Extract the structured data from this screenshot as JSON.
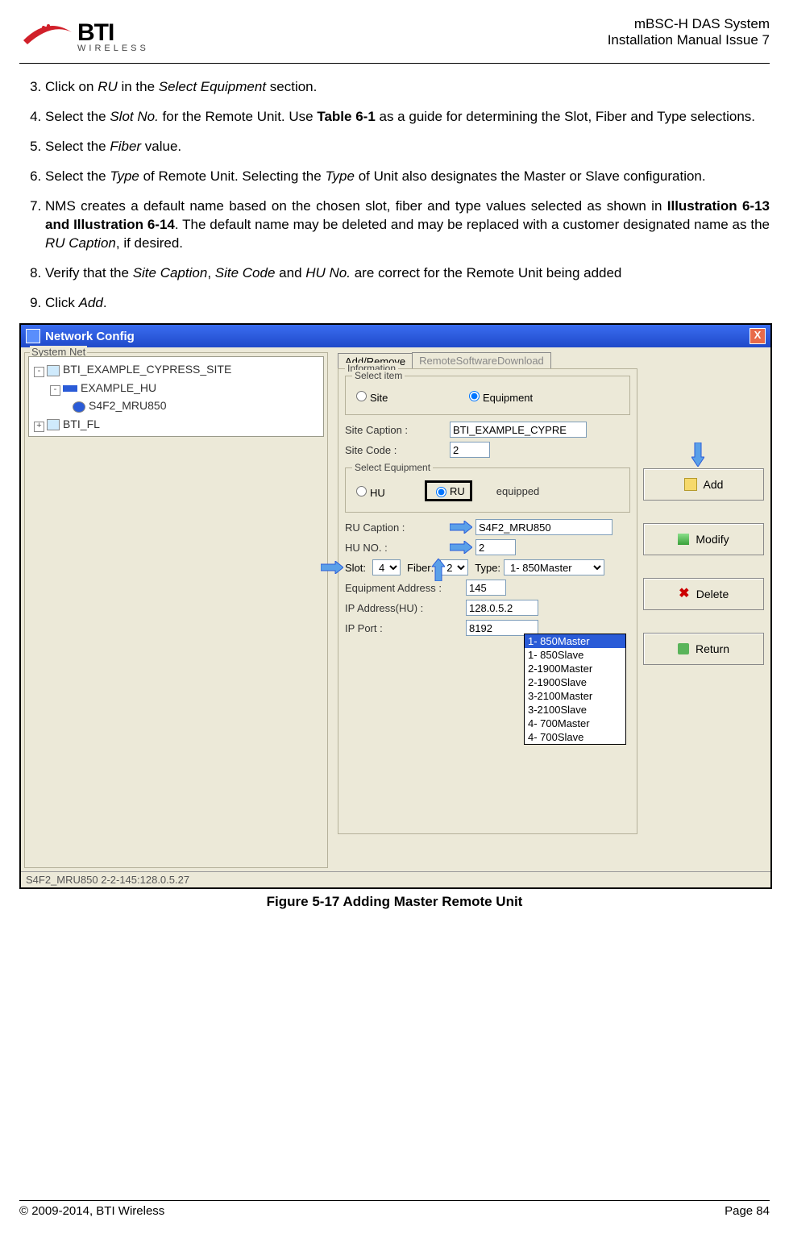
{
  "header": {
    "logo_main": "BTI",
    "logo_sub": "WIRELESS",
    "title1": "mBSC-H DAS System",
    "title2": "Installation Manual Issue 7"
  },
  "steps": {
    "s3_a": "Click on ",
    "s3_b": "RU",
    "s3_c": " in the ",
    "s3_d": "Select Equipment",
    "s3_e": " section.",
    "s4_a": "Select the ",
    "s4_b": "Slot No.",
    "s4_c": " for the Remote Unit. Use ",
    "s4_d": "Table 6-1",
    "s4_e": " as a guide for determining the Slot, Fiber and Type selections.",
    "s5_a": "Select the ",
    "s5_b": "Fiber",
    "s5_c": " value.",
    "s6_a": "Select the ",
    "s6_b": "Type",
    "s6_c": " of Remote Unit. Selecting the ",
    "s6_d": "Type",
    "s6_e": " of Unit also designates the Master or Slave configuration.",
    "s7_a": "NMS creates a default name based on the chosen slot, fiber and type values selected as shown in ",
    "s7_b": "Illustration 6-13 and Illustration 6-14",
    "s7_c": ". The default name may be deleted and may be replaced with a customer designated name as the ",
    "s7_d": "RU Caption",
    "s7_e": ", if desired.",
    "s8_a": "Verify that the ",
    "s8_b": "Site Caption",
    "s8_c": ", ",
    "s8_d": "Site Code",
    "s8_e": " and ",
    "s8_f": "HU No.",
    "s8_g": " are correct for the Remote Unit being added",
    "s9_a": "Click ",
    "s9_b": "Add",
    "s9_c": "."
  },
  "win": {
    "title": "Network Config",
    "left_label": "System Net",
    "tree": {
      "n1": "BTI_EXAMPLE_CYPRESS_SITE",
      "n2": "EXAMPLE_HU",
      "n3": "S4F2_MRU850",
      "n4": "BTI_FL"
    },
    "tabs": {
      "t1": "Add/Remove",
      "t2": "RemoteSoftwareDownload"
    },
    "info_label": "Information",
    "select_item": "Select item",
    "site": "Site",
    "equipment": "Equipment",
    "site_caption_lbl": "Site Caption :",
    "site_caption_val": "BTI_EXAMPLE_CYPRE",
    "site_code_lbl": "Site Code :",
    "site_code_val": "2",
    "select_equipment": "Select Equipment",
    "hu": "HU",
    "ru": "RU",
    "equipped": "equipped",
    "ru_caption_lbl": "RU Caption :",
    "ru_caption_val": "S4F2_MRU850",
    "hu_no_lbl": "HU NO. :",
    "hu_no_val": "2",
    "slot_lbl": "Slot:",
    "slot_val": "4",
    "fiber_lbl": "Fiber:",
    "fiber_val": "2",
    "type_lbl": "Type:",
    "type_val": "1- 850Master",
    "equip_addr_lbl": "Equipment Address :",
    "equip_addr_val": "145",
    "ip_addr_lbl": "IP Address(HU) :",
    "ip_addr_val": "128.0.5.2",
    "ip_port_lbl": "IP Port :",
    "ip_port_val": "8192",
    "type_options": [
      "1- 850Master",
      "1- 850Slave",
      "2-1900Master",
      "2-1900Slave",
      "3-2100Master",
      "3-2100Slave",
      "4- 700Master",
      "4- 700Slave"
    ],
    "btn_add": "Add",
    "btn_modify": "Modify",
    "btn_delete": "Delete",
    "btn_return": "Return",
    "status": "S4F2_MRU850 2-2-145:128.0.5.27"
  },
  "caption": "Figure 5-17 Adding Master Remote Unit",
  "footer": {
    "left": "© 2009-2014, BTI Wireless",
    "right": "Page 84"
  }
}
